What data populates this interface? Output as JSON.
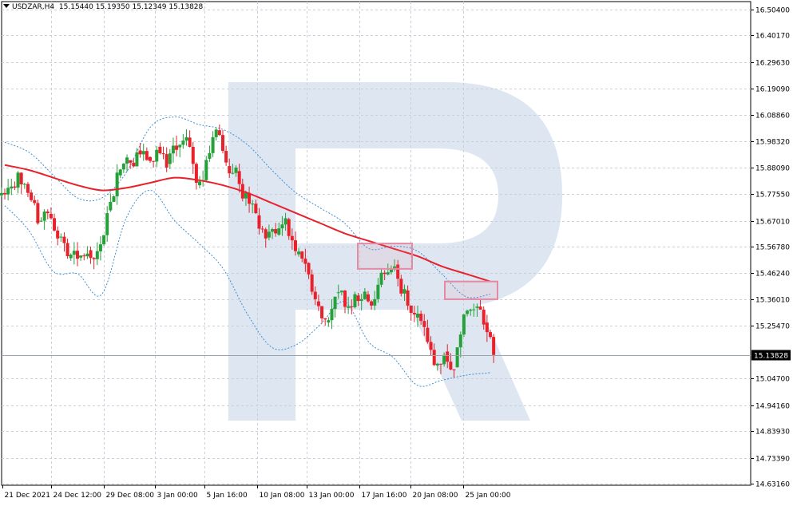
{
  "header": {
    "symbol": "USDZAR,H4",
    "ohlc": "15.15440 15.19350 15.12349 15.13828"
  },
  "current_price_label": "15.13828",
  "colors": {
    "bull": "#26a13a",
    "bear": "#e8212b",
    "ma": "#e8212b",
    "bands": "#3d8fd6",
    "grid": "#c8d0da",
    "highlight": "#e48aa4",
    "watermark": "#dde6f1"
  },
  "chart_data": {
    "type": "candlestick",
    "symbol": "USDZAR",
    "timeframe": "H4",
    "y_ticks": [
      "16.50400",
      "16.40170",
      "16.29630",
      "16.19090",
      "16.08860",
      "15.98320",
      "15.88090",
      "15.77550",
      "15.67010",
      "15.56780",
      "15.46240",
      "15.36010",
      "15.25470",
      "15.13828",
      "15.04700",
      "14.94160",
      "14.83930",
      "14.73390",
      "14.63160"
    ],
    "ylim": [
      14.6316,
      16.504
    ],
    "x_ticks": [
      "21 Dec 2021",
      "24 Dec 12:00",
      "29 Dec 08:00",
      "3 Jan 00:00",
      "5 Jan 16:00",
      "10 Jan 08:00",
      "13 Jan 00:00",
      "17 Jan 16:00",
      "20 Jan 08:00",
      "25 Jan 00:00"
    ],
    "series_close_path": [
      15.8,
      15.86,
      15.78,
      15.66,
      15.7,
      15.6,
      15.53,
      15.52,
      15.54,
      15.55,
      15.7,
      15.86,
      15.92,
      15.94,
      15.91,
      15.95,
      15.88,
      15.95,
      16.0,
      15.82,
      15.91,
      16.03,
      15.9,
      15.88,
      15.78,
      15.7,
      15.6,
      15.62,
      15.68,
      15.55,
      15.5,
      15.36,
      15.28,
      15.37,
      15.33,
      15.38,
      15.39,
      15.36,
      15.46,
      15.49,
      15.4,
      15.3,
      15.25,
      15.1,
      15.14,
      15.08,
      15.3,
      15.32,
      15.26,
      15.14
    ],
    "moving_average": [
      15.89,
      15.87,
      15.84,
      15.81,
      15.79,
      15.8,
      15.82,
      15.84,
      15.83,
      15.81,
      15.78,
      15.74,
      15.7,
      15.66,
      15.62,
      15.59,
      15.56,
      15.53,
      15.49,
      15.46,
      15.43
    ],
    "bollinger_upper": [
      15.98,
      15.94,
      15.85,
      15.76,
      15.76,
      15.86,
      16.04,
      16.08,
      16.05,
      16.03,
      15.97,
      15.87,
      15.78,
      15.72,
      15.66,
      15.56,
      15.57,
      15.55,
      15.46,
      15.37,
      15.38
    ],
    "bollinger_lower": [
      15.73,
      15.63,
      15.47,
      15.46,
      15.38,
      15.68,
      15.79,
      15.67,
      15.58,
      15.48,
      15.3,
      15.17,
      15.18,
      15.26,
      15.35,
      15.19,
      15.13,
      15.02,
      15.04,
      15.06,
      15.07
    ],
    "highlights": [
      {
        "label": "17 Jan",
        "price_top": 15.58,
        "price_bottom": 15.48
      },
      {
        "label": "25 Jan",
        "price_top": 15.43,
        "price_bottom": 15.36
      }
    ]
  }
}
